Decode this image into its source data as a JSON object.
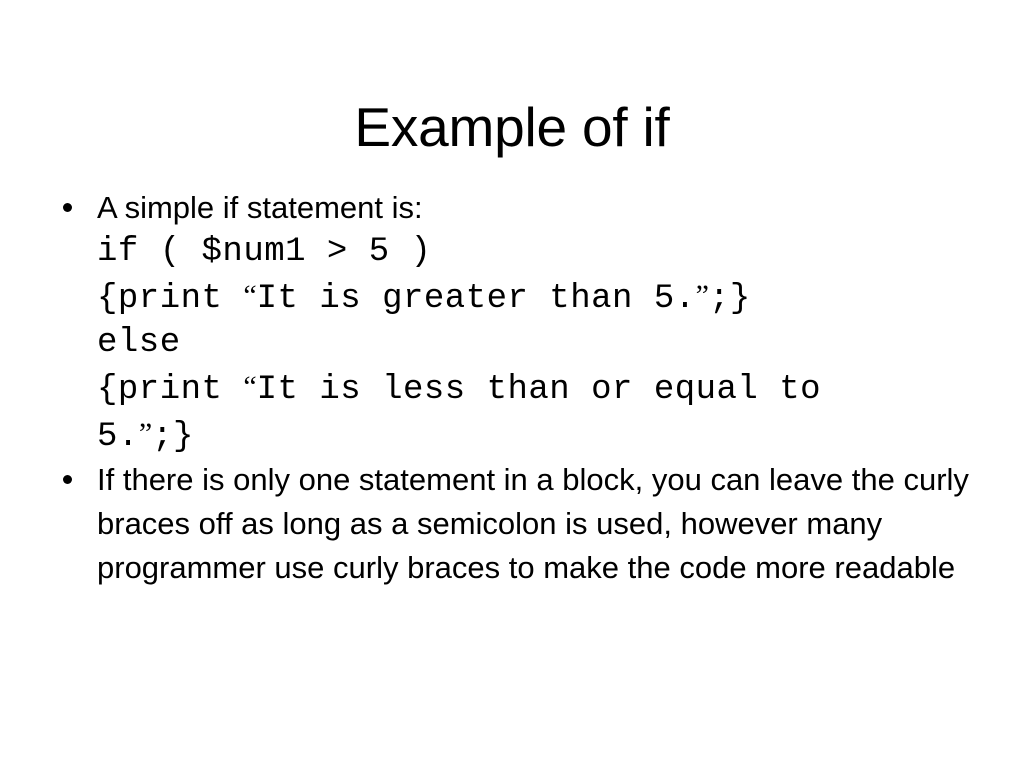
{
  "slide": {
    "title": "Example of if",
    "background_color": "#FFFFFF",
    "text_color": "#000000",
    "bullet_glyph": "•"
  },
  "bullets": [
    {
      "lead": "A simple if statement is:",
      "code_lines": [
        {
          "before": "if ( $num1 > 5 )",
          "open_quote": "",
          "middle": "",
          "close_quote": "",
          "after": ""
        },
        {
          "before": "{print ",
          "open_quote": "“",
          "middle": "It is greater than 5.",
          "close_quote": "”",
          "after": ";}"
        },
        {
          "before": "else",
          "open_quote": "",
          "middle": "",
          "close_quote": "",
          "after": ""
        },
        {
          "before": "{print ",
          "open_quote": "“",
          "middle": "It is less than or equal to",
          "close_quote": "",
          "after": ""
        },
        {
          "before": "5.",
          "open_quote": "",
          "middle": "",
          "close_quote": "”",
          "after": ";}"
        }
      ]
    },
    {
      "lead": "",
      "paragraph": "If there is only one statement in a block, you can leave the curly braces off as long as a semicolon is used, however many programmer use curly braces to make the code more readable"
    }
  ]
}
